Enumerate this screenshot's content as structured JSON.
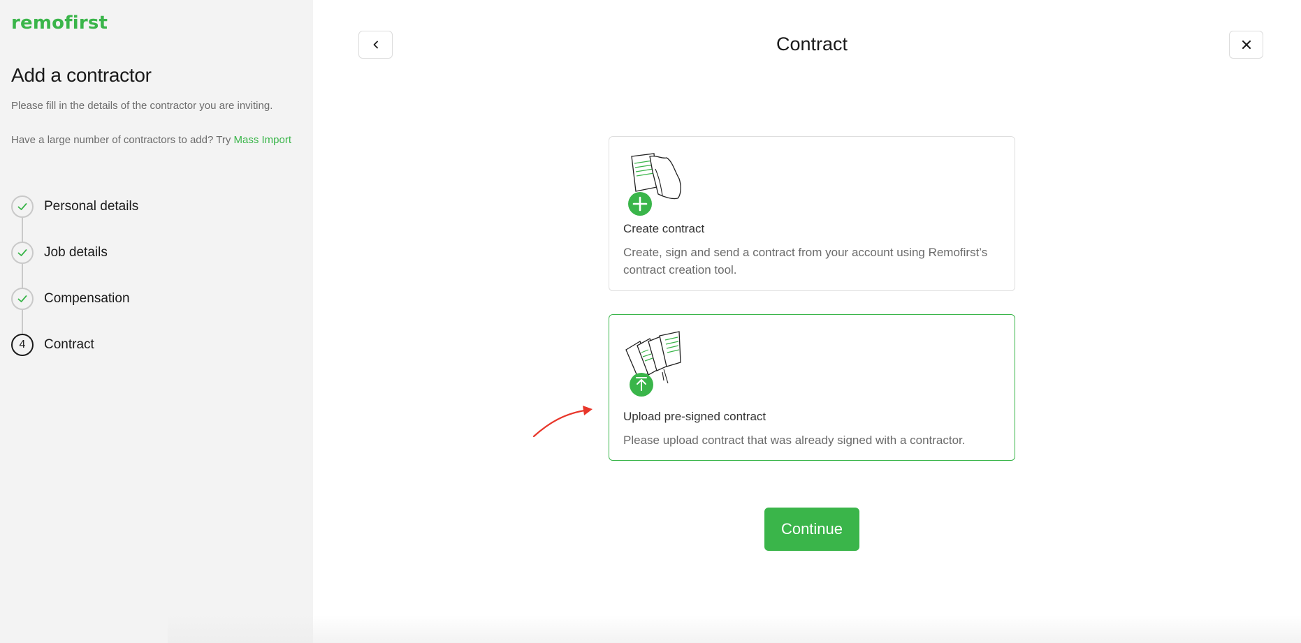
{
  "brand": {
    "logo_text": "remofirst",
    "accent_color": "#3ab54a"
  },
  "sidebar": {
    "title": "Add a contractor",
    "description": "Please fill in the details of the contractor you are inviting.",
    "mass_import_prefix": "Have a large number of contractors to add? Try ",
    "mass_import_link": "Mass Import",
    "steps": [
      {
        "label": "Personal details",
        "status": "completed",
        "icon": "check-icon"
      },
      {
        "label": "Job details",
        "status": "completed",
        "icon": "check-icon"
      },
      {
        "label": "Compensation",
        "status": "completed",
        "icon": "check-icon"
      },
      {
        "label": "Contract",
        "status": "active",
        "number": "4"
      }
    ]
  },
  "header": {
    "title": "Contract",
    "back_icon": "chevron-left-icon",
    "close_icon": "close-icon"
  },
  "options": [
    {
      "title": "Create contract",
      "description": "Create, sign and send a contract from your account using Remofirst’s contract creation tool.",
      "icon": "create-contract-illustration",
      "selected": false
    },
    {
      "title": "Upload pre-signed contract",
      "description": "Please upload contract that was already signed with a contractor.",
      "icon": "upload-contract-illustration",
      "selected": true
    }
  ],
  "actions": {
    "continue_label": "Continue"
  }
}
